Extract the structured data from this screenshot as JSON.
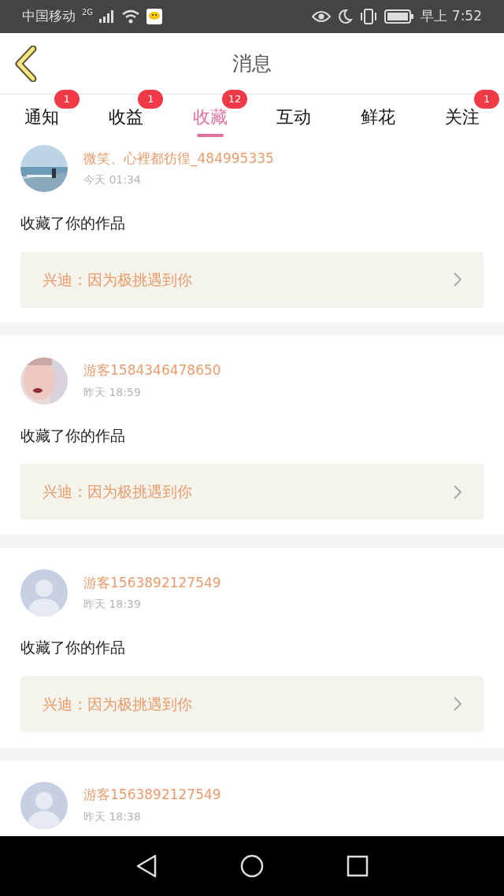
{
  "status_bar": {
    "carrier": "中国移动",
    "network": "2G",
    "time": "早上 7:52"
  },
  "header": {
    "title": "消息"
  },
  "tabs": [
    {
      "label": "通知",
      "badge": "1",
      "selected": false
    },
    {
      "label": "收益",
      "badge": "1",
      "selected": false
    },
    {
      "label": "收藏",
      "badge": "12",
      "selected": true
    },
    {
      "label": "互动",
      "selected": false
    },
    {
      "label": "鲜花",
      "selected": false
    },
    {
      "label": "关注",
      "badge": "1",
      "selected": false
    }
  ],
  "messages": [
    {
      "user": "微笑、心裡都彷徨_484995335",
      "time": "今天 01:34",
      "text": "收藏了你的作品",
      "work": "兴迪：因为极挑遇到你"
    },
    {
      "user": "游客1584346478650",
      "time": "昨天 18:59",
      "text": "收藏了你的作品",
      "work": "兴迪：因为极挑遇到你"
    },
    {
      "user": "游客1563892127549",
      "time": "昨天 18:39",
      "avatar": {
        "kind": "default"
      },
      "text": "收藏了你的作品",
      "work": "兴迪：因为极挑遇到你"
    },
    {
      "user": "游客1563892127549",
      "time": "昨天 18:38",
      "avatar": {
        "kind": "default"
      }
    }
  ]
}
